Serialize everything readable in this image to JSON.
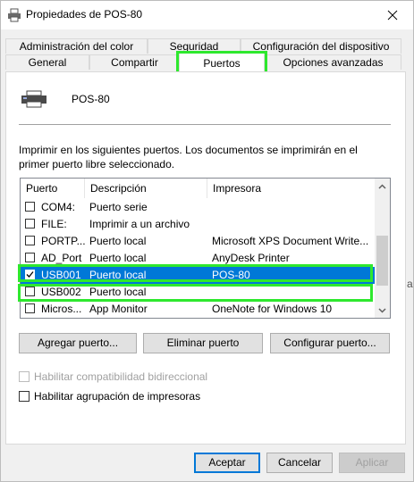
{
  "window": {
    "title": "Propiedades de POS-80"
  },
  "tabs_row1": [
    {
      "label": "Administración del color"
    },
    {
      "label": "Seguridad"
    },
    {
      "label": "Configuración del dispositivo"
    }
  ],
  "tabs_row2": [
    {
      "label": "General"
    },
    {
      "label": "Compartir"
    },
    {
      "label": "Puertos"
    },
    {
      "label": "Opciones avanzadas"
    }
  ],
  "printer": {
    "name": "POS-80"
  },
  "description": "Imprimir en los siguientes puertos. Los documentos se imprimirán en el primer puerto libre seleccionado.",
  "ports_table": {
    "columns": [
      "Puerto",
      "Descripción",
      "Impresora"
    ],
    "rows": [
      {
        "port": "COM4:",
        "description": "Puerto serie",
        "printer": "",
        "checked": false,
        "selected": false
      },
      {
        "port": "FILE:",
        "description": "Imprimir a un archivo",
        "printer": "",
        "checked": false,
        "selected": false
      },
      {
        "port": "PORTP...",
        "description": "Puerto local",
        "printer": "Microsoft XPS Document Write...",
        "checked": false,
        "selected": false
      },
      {
        "port": "AD_Port",
        "description": "Puerto local",
        "printer": "AnyDesk Printer",
        "checked": false,
        "selected": false
      },
      {
        "port": "USB001",
        "description": "Puerto local",
        "printer": "POS-80",
        "checked": true,
        "selected": true
      },
      {
        "port": "USB002",
        "description": "Puerto local",
        "printer": "",
        "checked": false,
        "selected": false
      },
      {
        "port": "Micros...",
        "description": "App Monitor",
        "printer": "OneNote for Windows 10",
        "checked": false,
        "selected": false
      }
    ]
  },
  "port_buttons": {
    "add": "Agregar puerto...",
    "delete": "Eliminar puerto",
    "configure": "Configurar puerto..."
  },
  "options": {
    "bidirectional": "Habilitar compatibilidad bidireccional",
    "pooling": "Habilitar agrupación de impresoras"
  },
  "dialog_buttons": {
    "ok": "Aceptar",
    "cancel": "Cancelar",
    "apply": "Aplicar"
  },
  "edge_fragment": "a",
  "colors": {
    "selection": "#0078d7",
    "highlight_annotation": "#2ee82e"
  }
}
